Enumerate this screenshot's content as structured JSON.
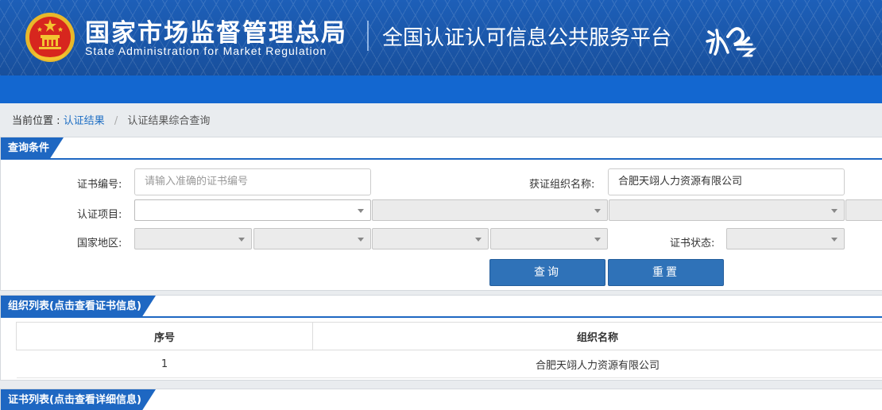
{
  "header": {
    "agency_cn": "国家市场监督管理总局",
    "agency_en": "State Administration  for  Market Regulation",
    "platform_title": "全国认证认可信息公共服务平台",
    "brand_colors": {
      "primary": "#1a56a8",
      "nav": "#1367d0",
      "emblem_red": "#d7261e",
      "emblem_gold": "#f3c431"
    }
  },
  "breadcrumb": {
    "label": "当前位置 :",
    "link": "认证结果",
    "separator": "/",
    "current": "认证结果综合查询"
  },
  "query_panel": {
    "title": "查询条件",
    "cert_no_label": "证书编号:",
    "cert_no_placeholder": "请输入准确的证书编号",
    "org_name_label": "获证组织名称:",
    "org_name_value": "合肥天翊人力资源有限公司",
    "project_label": "认证项目:",
    "region_label": "国家地区:",
    "status_label": "证书状态:",
    "search_button": "查询",
    "reset_button": "重置"
  },
  "org_panel": {
    "title": "组织列表(点击查看证书信息)",
    "columns": [
      "序号",
      "组织名称"
    ],
    "rows": [
      {
        "index": "1",
        "name": "合肥天翊人力资源有限公司"
      }
    ]
  },
  "cert_panel": {
    "title": "证书列表(点击查看详细信息)"
  }
}
